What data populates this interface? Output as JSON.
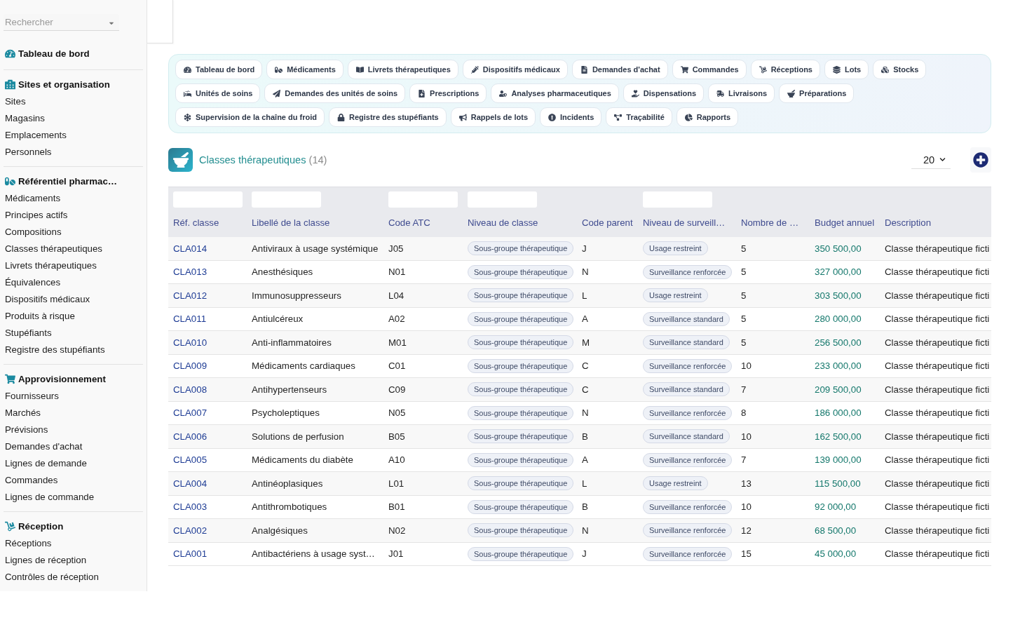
{
  "sidebar": {
    "search": {
      "placeholder": "Rechercher"
    },
    "sections": [
      {
        "title": "Tableau de bord"
      },
      {
        "title": "Sites et organisation",
        "items": [
          "Sites",
          "Magasins",
          "Emplacements",
          "Personnels"
        ]
      },
      {
        "title": "Référentiel pharmac…",
        "items": [
          "Médicaments",
          "Principes actifs",
          "Compositions",
          "Classes thérapeutiques",
          "Livrets thérapeutiques",
          "Équivalences",
          "Dispositifs médicaux",
          "Produits à risque",
          "Stupéfiants",
          "Registre des stupéfiants"
        ]
      },
      {
        "title": "Approvisionnement",
        "items": [
          "Fournisseurs",
          "Marchés",
          "Prévisions",
          "Demandes d'achat",
          "Lignes de demande",
          "Commandes",
          "Lignes de commande"
        ]
      },
      {
        "title": "Réception",
        "items": [
          "Réceptions",
          "Lignes de réception",
          "Contrôles de réception"
        ]
      }
    ]
  },
  "nav": {
    "rows": [
      [
        "Tableau de bord",
        "Médicaments",
        "Livrets thérapeutiques",
        "Dispositifs médicaux",
        "Demandes d'achat",
        "Commandes",
        "Réceptions",
        "Lots",
        "Stocks"
      ],
      [
        "Unités de soins",
        "Demandes des unités de soins",
        "Prescriptions",
        "Analyses pharmaceutiques",
        "Dispensations",
        "Livraisons",
        "Préparations"
      ],
      [
        "Supervision de la chaîne du froid",
        "Registre des stupéfiants",
        "Rappels de lots",
        "Incidents",
        "Traçabilité",
        "Rapports"
      ]
    ]
  },
  "header": {
    "title": "Classes thérapeutiques",
    "count": "(14)",
    "page_size": "20"
  },
  "table": {
    "columns": [
      {
        "label": "Réf. classe",
        "kind": "link",
        "filter": true
      },
      {
        "label": "Libellé de la classe",
        "kind": "text",
        "filter": true
      },
      {
        "label": "Code ATC",
        "kind": "text",
        "filter": true
      },
      {
        "label": "Niveau de classe",
        "kind": "badge",
        "filter": true
      },
      {
        "label": "Code parent",
        "kind": "text",
        "filter": false
      },
      {
        "label": "Niveau de surveill…",
        "kind": "badge",
        "filter": true
      },
      {
        "label": "Nombre de …",
        "kind": "text",
        "filter": false
      },
      {
        "label": "Budget annuel",
        "kind": "money",
        "filter": false
      },
      {
        "label": "Description",
        "kind": "text",
        "filter": false
      }
    ],
    "rows": [
      [
        "CLA014",
        "Antiviraux à usage systémique",
        "J05",
        "Sous-groupe thérapeutique",
        "J",
        "Usage restreint",
        "5",
        "350 500,00",
        "Classe thérapeutique ficti"
      ],
      [
        "CLA013",
        "Anesthésiques",
        "N01",
        "Sous-groupe thérapeutique",
        "N",
        "Surveillance renforcée",
        "5",
        "327 000,00",
        "Classe thérapeutique ficti"
      ],
      [
        "CLA012",
        "Immunosuppresseurs",
        "L04",
        "Sous-groupe thérapeutique",
        "L",
        "Usage restreint",
        "5",
        "303 500,00",
        "Classe thérapeutique ficti"
      ],
      [
        "CLA011",
        "Antiulcéreux",
        "A02",
        "Sous-groupe thérapeutique",
        "A",
        "Surveillance standard",
        "5",
        "280 000,00",
        "Classe thérapeutique ficti"
      ],
      [
        "CLA010",
        "Anti-inflammatoires",
        "M01",
        "Sous-groupe thérapeutique",
        "M",
        "Surveillance standard",
        "5",
        "256 500,00",
        "Classe thérapeutique ficti"
      ],
      [
        "CLA009",
        "Médicaments cardiaques",
        "C01",
        "Sous-groupe thérapeutique",
        "C",
        "Surveillance renforcée",
        "10",
        "233 000,00",
        "Classe thérapeutique ficti"
      ],
      [
        "CLA008",
        "Antihypertenseurs",
        "C09",
        "Sous-groupe thérapeutique",
        "C",
        "Surveillance standard",
        "7",
        "209 500,00",
        "Classe thérapeutique ficti"
      ],
      [
        "CLA007",
        "Psycholeptiques",
        "N05",
        "Sous-groupe thérapeutique",
        "N",
        "Surveillance renforcée",
        "8",
        "186 000,00",
        "Classe thérapeutique ficti"
      ],
      [
        "CLA006",
        "Solutions de perfusion",
        "B05",
        "Sous-groupe thérapeutique",
        "B",
        "Surveillance standard",
        "10",
        "162 500,00",
        "Classe thérapeutique ficti"
      ],
      [
        "CLA005",
        "Médicaments du diabète",
        "A10",
        "Sous-groupe thérapeutique",
        "A",
        "Surveillance renforcée",
        "7",
        "139 000,00",
        "Classe thérapeutique ficti"
      ],
      [
        "CLA004",
        "Antinéoplasiques",
        "L01",
        "Sous-groupe thérapeutique",
        "L",
        "Usage restreint",
        "13",
        "115 500,00",
        "Classe thérapeutique ficti"
      ],
      [
        "CLA003",
        "Antithrombotiques",
        "B01",
        "Sous-groupe thérapeutique",
        "B",
        "Surveillance renforcée",
        "10",
        "92 000,00",
        "Classe thérapeutique ficti"
      ],
      [
        "CLA002",
        "Analgésiques",
        "N02",
        "Sous-groupe thérapeutique",
        "N",
        "Surveillance renforcée",
        "12",
        "68 500,00",
        "Classe thérapeutique ficti"
      ],
      [
        "CLA001",
        "Antibactériens à usage syst…",
        "J01",
        "Sous-groupe thérapeutique",
        "J",
        "Surveillance renforcée",
        "15",
        "45 000,00",
        "Classe thérapeutique ficti"
      ]
    ]
  }
}
